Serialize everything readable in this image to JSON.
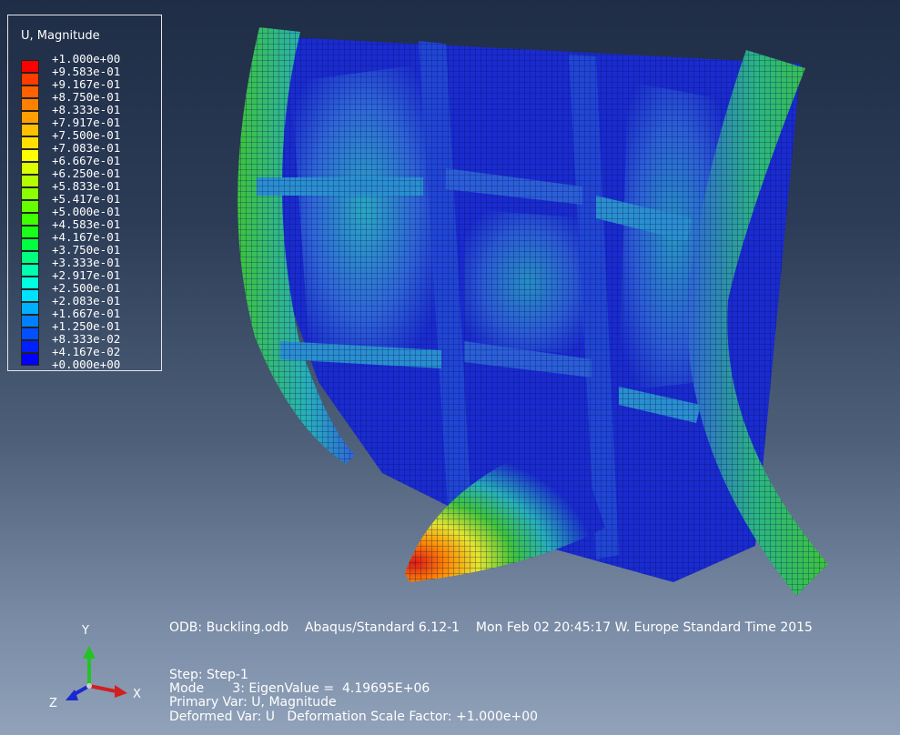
{
  "legend": {
    "title": "U, Magnitude",
    "entries": [
      {
        "value": "+1.000e+00",
        "color": "#ff0000"
      },
      {
        "value": "+9.583e-01",
        "color": "#ff3b00"
      },
      {
        "value": "+9.167e-01",
        "color": "#ff6000"
      },
      {
        "value": "+8.750e-01",
        "color": "#ff8000"
      },
      {
        "value": "+8.333e-01",
        "color": "#ffa000"
      },
      {
        "value": "+7.917e-01",
        "color": "#ffc000"
      },
      {
        "value": "+7.500e-01",
        "color": "#ffe000"
      },
      {
        "value": "+7.083e-01",
        "color": "#ffff00"
      },
      {
        "value": "+6.667e-01",
        "color": "#d9ff00"
      },
      {
        "value": "+6.250e-01",
        "color": "#b3ff00"
      },
      {
        "value": "+5.833e-01",
        "color": "#8cff00"
      },
      {
        "value": "+5.417e-01",
        "color": "#66ff00"
      },
      {
        "value": "+5.000e-01",
        "color": "#3fff00"
      },
      {
        "value": "+4.583e-01",
        "color": "#19ff19"
      },
      {
        "value": "+4.167e-01",
        "color": "#00ff40"
      },
      {
        "value": "+3.750e-01",
        "color": "#00ff80"
      },
      {
        "value": "+3.333e-01",
        "color": "#00ffb0"
      },
      {
        "value": "+2.917e-01",
        "color": "#00ffe0"
      },
      {
        "value": "+2.500e-01",
        "color": "#00e0ff"
      },
      {
        "value": "+2.083e-01",
        "color": "#00b0ff"
      },
      {
        "value": "+1.667e-01",
        "color": "#0080ff"
      },
      {
        "value": "+1.250e-01",
        "color": "#0050ff"
      },
      {
        "value": "+8.333e-02",
        "color": "#0020ff"
      },
      {
        "value": "+4.167e-02",
        "color": "#0000ff"
      },
      {
        "value": "+0.000e+00",
        "color": "#0000ff"
      }
    ]
  },
  "info": {
    "odb_line": "ODB: Buckling.odb    Abaqus/Standard 6.12-1    Mon Feb 02 20:45:17 W. Europe Standard Time 2015",
    "step_line": "Step: Step-1",
    "mode_line": "Mode       3: EigenValue =  4.19695E+06",
    "primary_line": "Primary Var: U, Magnitude",
    "deformed_line": "Deformed Var: U   Deformation Scale Factor: +1.000e+00"
  },
  "triad": {
    "x_label": "X",
    "y_label": "Y",
    "z_label": "Z"
  },
  "colors": {
    "deep_blue": "#1a2bd0",
    "mid_blue": "#2f66d8",
    "teal": "#27b0b8",
    "green": "#3ec43a",
    "yellow": "#e6e62a",
    "red": "#e21a10"
  }
}
